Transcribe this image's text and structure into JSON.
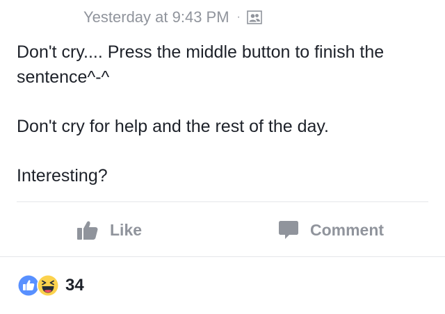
{
  "post": {
    "timestamp": "Yesterday at 9:43 PM",
    "separator": "·",
    "audience_icon": "friends-icon",
    "paragraphs": [
      "Don't cry.... Press the middle button to finish the sentence^-^",
      "Don't cry for help and the rest of the day.",
      "Interesting?"
    ]
  },
  "actions": {
    "like_label": "Like",
    "comment_label": "Comment",
    "like_icon": "thumbs-up-icon",
    "comment_icon": "speech-bubble-icon"
  },
  "reactions": {
    "icons": [
      "like-reaction-icon",
      "haha-reaction-icon"
    ],
    "count": "34"
  },
  "colors": {
    "text": "#1d2129",
    "muted": "#90949c",
    "like_blue": "#4267b2",
    "haha_yellow": "#fcd24d"
  }
}
